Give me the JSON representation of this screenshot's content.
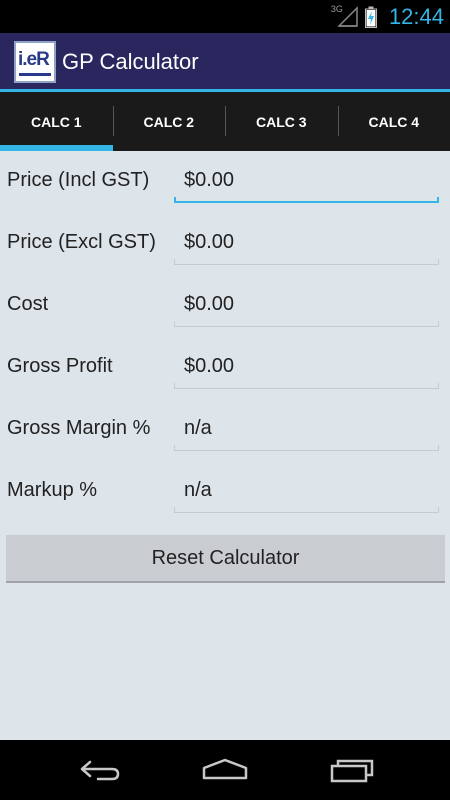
{
  "status_bar": {
    "network_type": "3G",
    "time": "12:44",
    "icons": [
      "signal-icon",
      "battery-charging-icon"
    ]
  },
  "app": {
    "logo_text": "i.eR",
    "title": "GP Calculator"
  },
  "tabs": [
    {
      "label": "CALC 1",
      "active": true
    },
    {
      "label": "CALC 2",
      "active": false
    },
    {
      "label": "CALC 3",
      "active": false
    },
    {
      "label": "CALC 4",
      "active": false
    }
  ],
  "fields": [
    {
      "label": "Price (Incl GST)",
      "value": "$0.00"
    },
    {
      "label": "Price (Excl GST)",
      "value": "$0.00"
    },
    {
      "label": "Cost",
      "value": "$0.00"
    },
    {
      "label": "Gross Profit",
      "value": "$0.00"
    },
    {
      "label": "Gross Margin %",
      "value": "n/a"
    },
    {
      "label": "Markup %",
      "value": "n/a"
    }
  ],
  "reset_button": {
    "label": "Reset Calculator"
  },
  "nav_bar": {
    "icons": [
      "back-icon",
      "home-icon",
      "recent-apps-icon"
    ]
  },
  "colors": {
    "accent": "#33b5e5",
    "action_bar": "#2a275f",
    "content_bg": "#dde4ea",
    "tab_bar": "#1a1a1a"
  }
}
